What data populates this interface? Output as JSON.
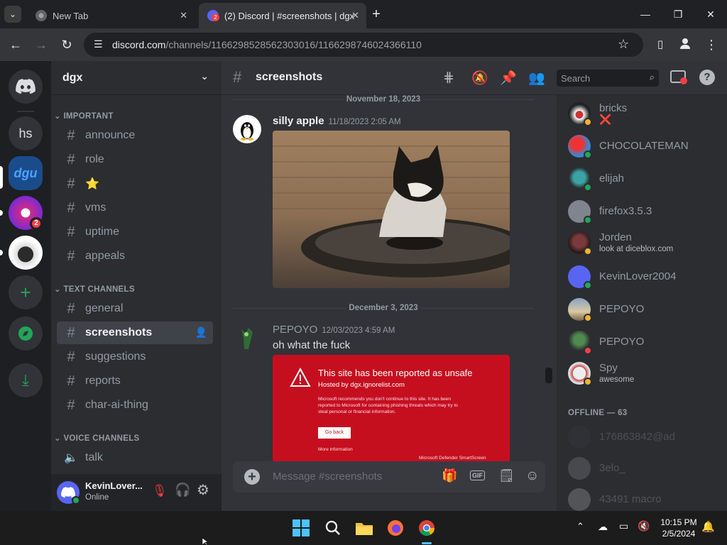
{
  "browser": {
    "tabs": [
      {
        "title": "New Tab"
      },
      {
        "title": "(2) Discord | #screenshots | dgx",
        "badge": "2"
      }
    ],
    "url_host": "discord.com",
    "url_path": "/channels/1166298528562303016/1166298746024366110"
  },
  "servers": {
    "items": [
      {
        "label": "hs"
      },
      {
        "label": "dgu"
      },
      {
        "badge": "2"
      }
    ]
  },
  "guild": {
    "name": "dgx",
    "categories": [
      {
        "label": "IMPORTANT"
      },
      {
        "label": "TEXT CHANNELS"
      },
      {
        "label": "VOICE CHANNELS"
      }
    ],
    "channels": [
      "announce",
      "role",
      "⭐",
      "vms",
      "uptime",
      "appeals",
      "general",
      "screenshots",
      "suggestions",
      "reports",
      "char-ai-thing",
      "talk"
    ]
  },
  "user": {
    "name": "KevinLover...",
    "status": "Online"
  },
  "chat": {
    "channel": "screenshots",
    "search_placeholder": "Search",
    "input_placeholder": "Message #screenshots",
    "gif_label": "GIF",
    "dividers": [
      "November 18, 2023",
      "December 3, 2023"
    ],
    "messages": [
      {
        "author": "silly apple",
        "timestamp": "11/18/2023 2:05 AM"
      },
      {
        "author": "PEPOYO",
        "timestamp": "12/03/2023 4:59 AM",
        "text": "oh what the fuck"
      }
    ],
    "unsafe_card": {
      "title": "This site has been reported as unsafe",
      "host": "Hosted by dgx.ignorelist.com",
      "body": "Microsoft recommends you don't continue to this site. It has been reported to Microsoft for containing phishing threats which may try to steal personal or financial information.",
      "button": "Go back",
      "more": "More information",
      "footer": "Microsoft Defender SmartScreen"
    }
  },
  "members": {
    "online": [
      {
        "name": "bricks",
        "sub": "❌",
        "color": "#eef0f1"
      },
      {
        "name": "CHOCOLATEMAN"
      },
      {
        "name": "elijah"
      },
      {
        "name": "firefox3.5.3"
      },
      {
        "name": "Jorden",
        "sub": "look at diceblox.com"
      },
      {
        "name": "KevinLover2004"
      },
      {
        "name": "PEPOYO"
      },
      {
        "name": "PEPOYO"
      },
      {
        "name": "Spy",
        "sub": "awesome"
      }
    ],
    "offline_header": "OFFLINE — 63",
    "offline": [
      {
        "name": "176863842@ad"
      },
      {
        "name": "3elo_"
      },
      {
        "name": "43491 macro"
      }
    ]
  },
  "taskbar": {
    "time": "10:15 PM",
    "date": "2/5/2024"
  },
  "colors": {
    "blurple": "#5865f2",
    "online": "#23a55a",
    "idle": "#f0b232",
    "dnd": "#f23f43",
    "unsafe_red": "#c50f1f"
  }
}
